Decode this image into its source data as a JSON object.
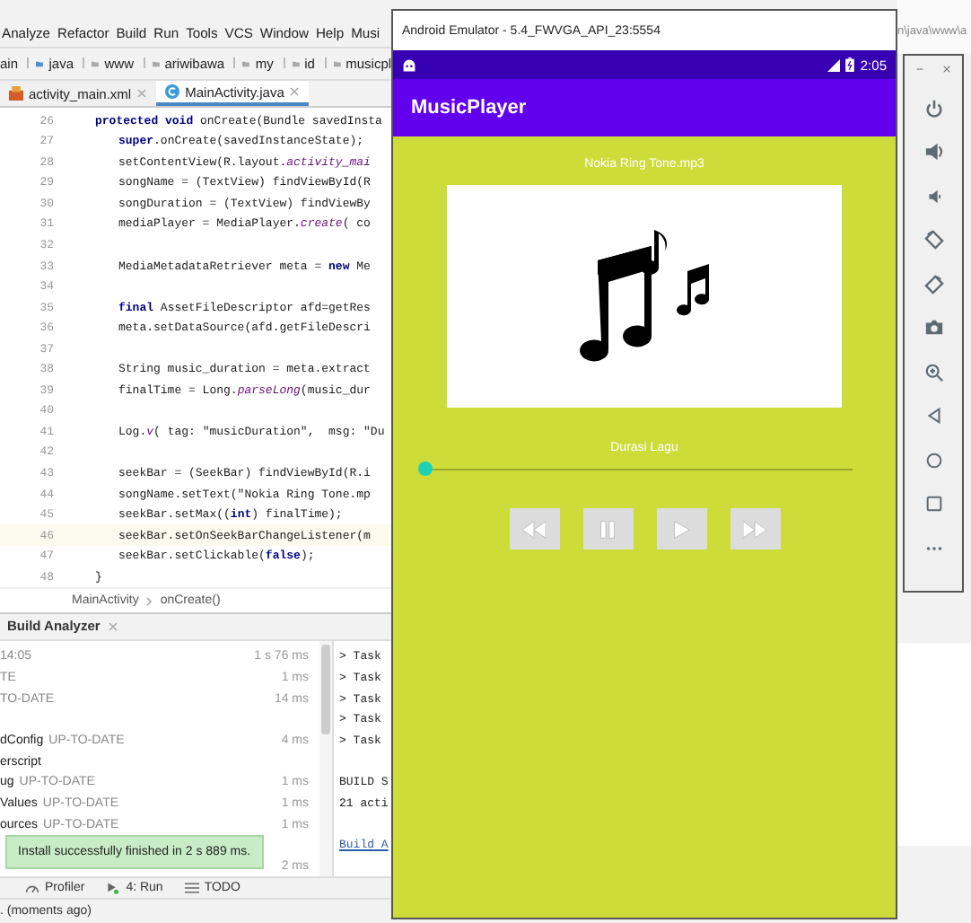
{
  "ide": {
    "menu": [
      "Analyze",
      "Refactor",
      "Build",
      "Run",
      "Tools",
      "VCS",
      "Window",
      "Help",
      "Musi"
    ],
    "title_path": "n\\java\\www\\a",
    "breadcrumb": [
      {
        "label": "ain",
        "kind": "text"
      },
      {
        "label": "java",
        "kind": "source-folder"
      },
      {
        "label": "www",
        "kind": "folder"
      },
      {
        "label": "ariwibawa",
        "kind": "folder"
      },
      {
        "label": "my",
        "kind": "folder"
      },
      {
        "label": "id",
        "kind": "folder"
      },
      {
        "label": "musicpl",
        "kind": "folder"
      }
    ],
    "tabs": [
      {
        "label": "activity_main.xml",
        "kind": "xml",
        "selected": false
      },
      {
        "label": "MainActivity.java",
        "kind": "java",
        "selected": true
      }
    ],
    "code_lines": [
      {
        "number": "26",
        "code": "**protected void** onCreate(Bundle savedInsta",
        "kind": "signature",
        "current": false
      },
      {
        "number": "27",
        "code": "**super**.onCreate(savedInstanceState);",
        "kind": "body",
        "current": false
      },
      {
        "number": "28",
        "code": "setContentView(R.layout.*activity_mai*",
        "kind": "body",
        "current": false
      },
      {
        "number": "29",
        "code": "songName = (TextView) findViewById(R",
        "kind": "body",
        "current": false
      },
      {
        "number": "30",
        "code": "songDuration = (TextView) findViewBy",
        "kind": "body",
        "current": false
      },
      {
        "number": "31",
        "code": "mediaPlayer = MediaPlayer.*create*( co",
        "kind": "body",
        "current": false
      },
      {
        "number": "32",
        "kind": "blank",
        "current": false
      },
      {
        "number": "33",
        "code": "MediaMetadataRetriever meta = **new** Me",
        "kind": "body",
        "current": false
      },
      {
        "number": "34",
        "kind": "blank",
        "current": false
      },
      {
        "number": "35",
        "code": "**final** AssetFileDescriptor afd=getRes",
        "kind": "body",
        "current": false
      },
      {
        "number": "36",
        "code": "meta.setDataSource(afd.getFileDescri",
        "kind": "body",
        "current": false
      },
      {
        "number": "37",
        "kind": "blank",
        "current": false
      },
      {
        "number": "38",
        "code": "String music_duration = meta.extract",
        "kind": "body",
        "current": false
      },
      {
        "number": "39",
        "code": "finalTime = Long.*parseLong*(music_dur",
        "kind": "body",
        "current": false
      },
      {
        "number": "40",
        "kind": "blank",
        "current": false
      },
      {
        "number": "41",
        "code": "Log.*v*( tag: \"musicDuration\",  msg: \"Du",
        "kind": "body",
        "current": false
      },
      {
        "number": "42",
        "kind": "blank",
        "current": false
      },
      {
        "number": "43",
        "code": "seekBar = (SeekBar) findViewById(R.i",
        "kind": "body",
        "current": false
      },
      {
        "number": "44",
        "code": "songName.setText(\"Nokia Ring Tone.mp",
        "kind": "body",
        "current": false
      },
      {
        "number": "45",
        "code": "seekBar.setMax((**int**) finalTime);",
        "kind": "body",
        "current": false
      },
      {
        "number": "46",
        "code": "seekBar.setOnSeekBarChangeListener(m",
        "kind": "body",
        "current": true
      },
      {
        "number": "47",
        "code": "seekBar.setClickable(**false**);",
        "kind": "body",
        "current": false
      },
      {
        "number": "48",
        "code": "}",
        "kind": "signature",
        "current": false
      }
    ],
    "footer_breadcrumb": [
      "MainActivity",
      "onCreate()"
    ],
    "tool_window": {
      "title": "Build Analyzer"
    },
    "build_tasks": [
      {
        "kind": "task",
        "status": "14:05",
        "time": "1 s 76 ms"
      },
      {
        "kind": "task",
        "status": "TE",
        "time": "1 ms"
      },
      {
        "kind": "task",
        "status": "TO-DATE",
        "time": "14 ms"
      },
      {
        "kind": "gap"
      },
      {
        "kind": "task",
        "task": "dConfig",
        "status": "UP-TO-DATE",
        "time": "4 ms"
      },
      {
        "kind": "task",
        "task": "erscript"
      },
      {
        "kind": "task",
        "task": "ug",
        "status": "UP-TO-DATE",
        "time": "1 ms"
      },
      {
        "kind": "task",
        "task": "Values",
        "status": "UP-TO-DATE",
        "time": "1 ms"
      },
      {
        "kind": "task",
        "task": "ources",
        "status": "UP-TO-DATE",
        "time": "1 ms"
      },
      {
        "kind": "gap"
      },
      {
        "kind": "task",
        "time": "2 ms"
      }
    ],
    "build_output": [
      {
        "text": "> Task",
        "kind": "line"
      },
      {
        "text": "> Task",
        "kind": "line"
      },
      {
        "text": "> Task",
        "kind": "line"
      },
      {
        "text": "> Task",
        "kind": "line"
      },
      {
        "text": "> Task",
        "kind": "line"
      },
      {
        "kind": "blank"
      },
      {
        "text": "BUILD S",
        "kind": "line"
      },
      {
        "text": "21 acti",
        "kind": "line"
      },
      {
        "kind": "blank"
      },
      {
        "text": "Build A",
        "kind": "link"
      }
    ],
    "notification": "Install successfully finished in 2 s 889 ms.",
    "bottom_tabs": [
      {
        "label": "Profiler",
        "kind": "profiler"
      },
      {
        "label": "4: Run",
        "kind": "run"
      },
      {
        "label": "TODO",
        "kind": "todo"
      }
    ],
    "status_bar": ". (moments ago)"
  },
  "emulator": {
    "title": "Android Emulator - 5.4_FWVGA_API_23:5554",
    "clock": "2:05",
    "app_title": "MusicPlayer",
    "song_title": "Nokia Ring Tone.mp3",
    "duration_label": "Durasi Lagu",
    "seek": {
      "level": 0
    },
    "controls": [
      {
        "kind": "rewind"
      },
      {
        "kind": "pause"
      },
      {
        "kind": "play"
      },
      {
        "kind": "forward"
      }
    ],
    "side_toolbar": [
      {
        "kind": "power"
      },
      {
        "kind": "volume-up"
      },
      {
        "kind": "volume-down"
      },
      {
        "kind": "rotate-left"
      },
      {
        "kind": "rotate-right"
      },
      {
        "kind": "camera"
      },
      {
        "kind": "zoom"
      },
      {
        "kind": "back"
      },
      {
        "kind": "home"
      },
      {
        "kind": "overview"
      },
      {
        "kind": "more"
      }
    ]
  }
}
